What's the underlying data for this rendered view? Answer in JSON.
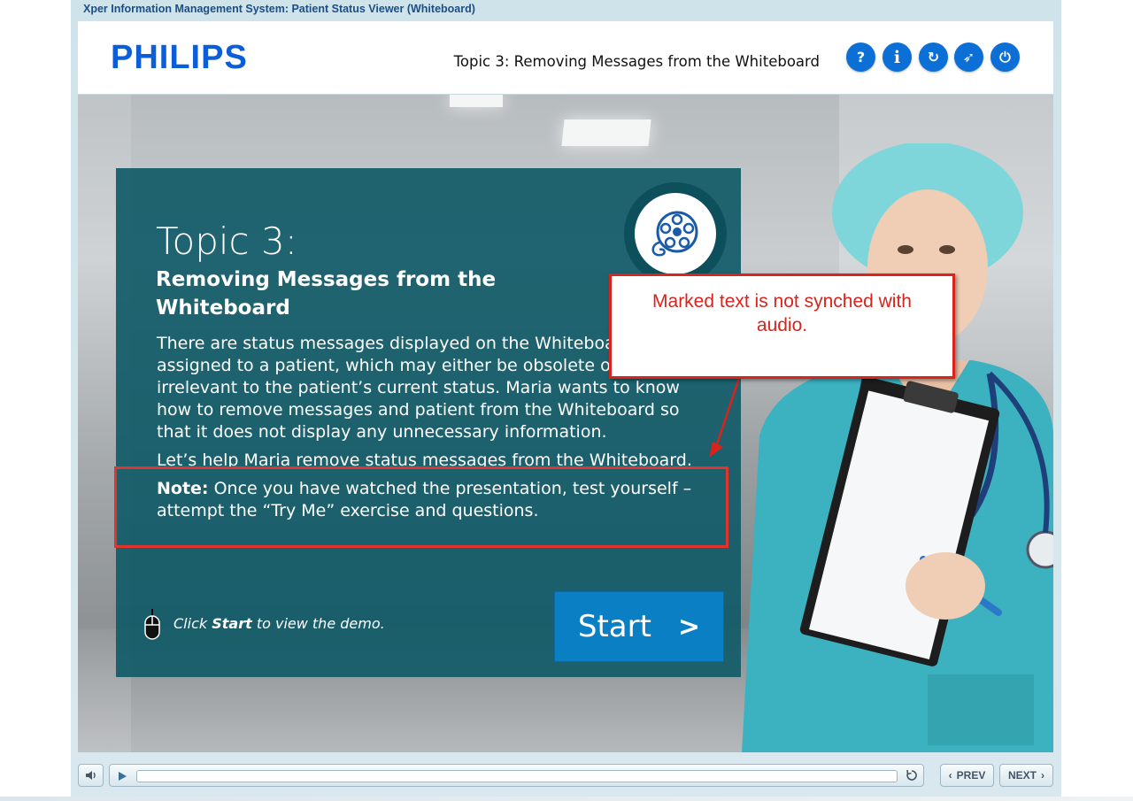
{
  "window": {
    "title": "Xper Information Management System: Patient Status Viewer (Whiteboard)"
  },
  "header": {
    "logo_text": "PHILIPS",
    "topic_title": "Topic 3: Removing Messages from the Whiteboard",
    "buttons": [
      {
        "icon": "help-icon",
        "glyph": "?"
      },
      {
        "icon": "info-icon",
        "glyph": "i"
      },
      {
        "icon": "replay-icon",
        "glyph": "↻"
      },
      {
        "icon": "compass-icon",
        "glyph": "➶"
      },
      {
        "icon": "power-icon",
        "glyph": "⏻"
      }
    ]
  },
  "content": {
    "topic_number": "Topic 3:",
    "topic_subtitle": "Removing Messages from the Whiteboard",
    "intro": "There are status messages displayed on the Whiteboard assigned to a patient, which may either be obsolete or are irrelevant to the patient’s current status. Maria wants to know how to remove messages and patient from the Whiteboard so that it does not display any unnecessary information.",
    "help_line": "Let’s help Maria remove status messages from the Whiteboard.",
    "note_label": "Note:",
    "note_text": "Once you have watched the presentation, test yourself – attempt the “Try Me” exercise and questions.",
    "instruction_prefix": "Click ",
    "instruction_bold": "Start",
    "instruction_suffix": " to view the demo.",
    "start_label": "Start",
    "start_arrow": ">"
  },
  "annotation": {
    "callout_text": "Marked text is not synched with audio.",
    "highlight_color": "#e0342f"
  },
  "controls": {
    "prev_label": "PREV",
    "next_label": "NEXT",
    "progress": 0
  },
  "colors": {
    "accent": "#0b6fd6",
    "panel": "#125b68",
    "start_button": "#0a7fc4"
  }
}
